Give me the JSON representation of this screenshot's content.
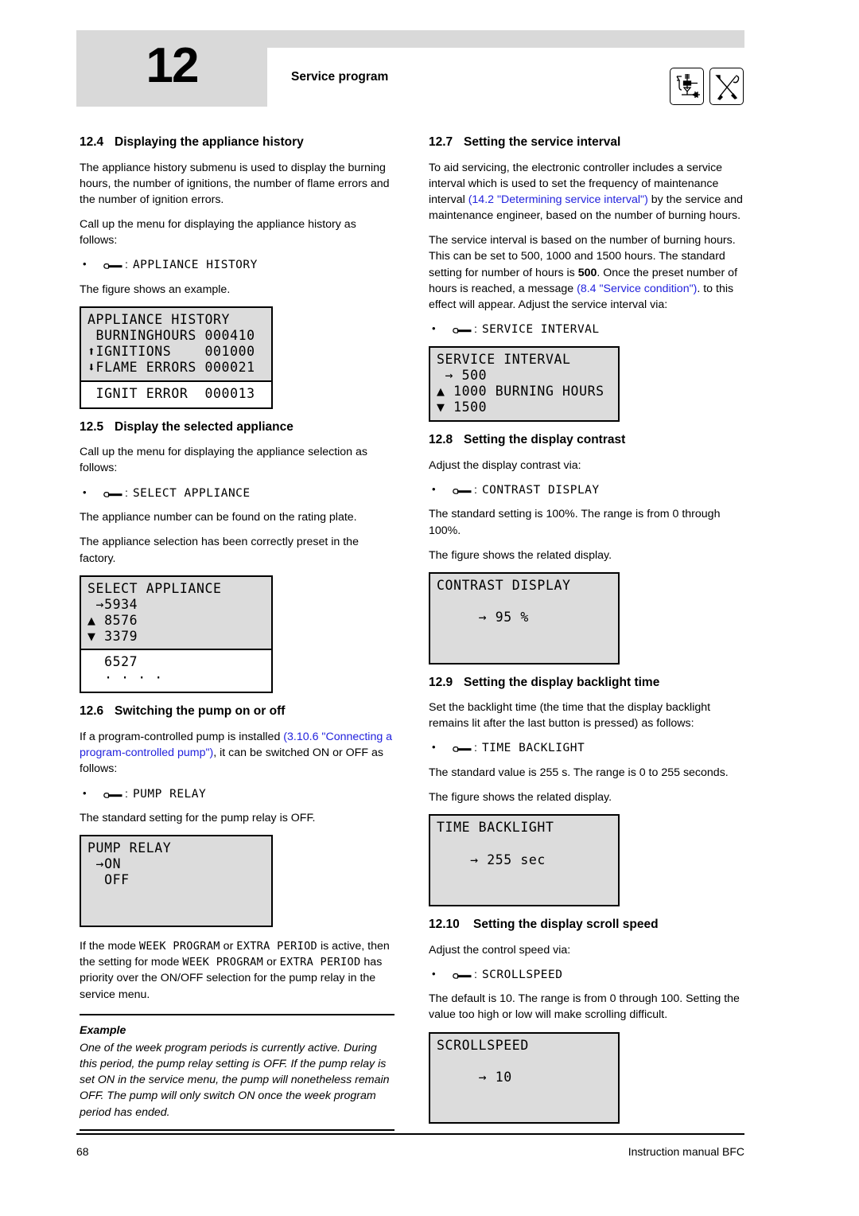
{
  "header": {
    "chapter_number": "12",
    "chapter_title": "Service program",
    "icons": [
      "gas-valve-train-icon",
      "crossed-tools-icon"
    ]
  },
  "colors": {
    "link": "#2222dd",
    "header_band": "#d9d9d9",
    "lcd_background": "#dcdcdc",
    "lcd_border": "#000000"
  },
  "left_column": {
    "sections": [
      {
        "number": "12.4",
        "title": "Displaying the appliance history",
        "paragraphs": [
          "The appliance history submenu is used to display the burning hours, the number of ignitions, the number of flame errors and the number of ignition errors.",
          "Call up the menu for displaying the appliance history as follows:"
        ],
        "bullet": {
          "icon": "wrench-icon",
          "separator": ":",
          "menu_path": "APPLIANCE HISTORY"
        },
        "bullet_note": "The figure shows an example.",
        "lcd": {
          "name": "appliance-history-display",
          "lines": [
            "APPLIANCE HISTORY",
            " BURNINGHOURS 000410",
            "⬆IGNITIONS    001000",
            "⬇FLAME ERRORS 000021"
          ],
          "white_lines": [
            " IGNIT ERROR  000013"
          ]
        }
      },
      {
        "number": "12.5",
        "title": "Display the selected appliance",
        "paragraphs": [
          "Call up the menu for displaying the appliance selection as follows:"
        ],
        "bullet": {
          "icon": "wrench-icon",
          "separator": ":",
          "menu_path": "SELECT APPLIANCE"
        },
        "indent_paragraphs": [
          "The appliance number can be found on the rating plate.",
          "The appliance selection has been correctly preset in the factory."
        ],
        "lcd": {
          "name": "select-appliance-display",
          "lines": [
            "SELECT APPLIANCE",
            " →5934",
            "▲ 8576",
            "▼ 3379"
          ],
          "white_lines": [
            "  6527",
            "  · · · ·"
          ]
        }
      },
      {
        "number": "12.6",
        "title": "Switching the pump on or off",
        "rich_paragraph": {
          "part1": "If a program-controlled pump is installed ",
          "link": "(3.10.6 \"Connecting a program-controlled pump\")",
          "part2": ", it can be switched ON or OFF as follows:"
        },
        "bullet": {
          "icon": "wrench-icon",
          "separator": ":",
          "menu_path": "PUMP RELAY"
        },
        "indent_paragraphs": [
          "The standard setting for the pump relay is OFF."
        ],
        "lcd": {
          "name": "pump-relay-display",
          "lines": [
            "PUMP RELAY",
            " →ON",
            "  OFF",
            ""
          ]
        },
        "mode_paragraph": {
          "t1": "If the mode ",
          "m1": "WEEK PROGRAM",
          "t2": " or ",
          "m2": "EXTRA PERIOD",
          "t3": " is active, then the setting for mode ",
          "m3": "WEEK PROGRAM",
          "t4": " or ",
          "m4": "EXTRA PERIOD",
          "t5": " has priority over the ON/OFF selection for the pump relay in the service menu."
        },
        "example": {
          "heading": "Example",
          "text": "One of the week program periods is currently active. During this period, the pump relay setting is OFF. If the pump relay is set ON in the service menu, the pump will nonetheless remain OFF. The pump will only switch ON once the week program period has ended."
        }
      }
    ]
  },
  "right_column": {
    "sections": [
      {
        "number": "12.7",
        "title": "Setting the service interval",
        "rich_paragraph_1": {
          "part1": "To aid servicing, the electronic controller includes a service interval which is used to set the frequency of maintenance interval ",
          "link": "(14.2 \"Determining service interval\")",
          "part2": " by the service and maintenance engineer, based on the number of burning hours."
        },
        "rich_paragraph_2": {
          "part1": "The service interval is based on the number of burning hours. This can be set to 500, 1000 and 1500 hours. The standard setting for number of hours is ",
          "bold": "500",
          "part2": ". Once the preset number of hours is reached, a message ",
          "link": "(8.4 \"Service condition\")",
          "part3": ". to this effect will appear. Adjust the service interval via:"
        },
        "bullet": {
          "icon": "wrench-icon",
          "separator": ":",
          "menu_path": "SERVICE INTERVAL"
        },
        "lcd": {
          "name": "service-interval-display",
          "lines": [
            "SERVICE INTERVAL",
            " → 500",
            "▲ 1000 BURNING HOURS",
            "▼ 1500"
          ]
        }
      },
      {
        "number": "12.8",
        "title": "Setting the display contrast",
        "paragraphs": [
          "Adjust the display contrast via:"
        ],
        "bullet": {
          "icon": "wrench-icon",
          "separator": ":",
          "menu_path": "CONTRAST DISPLAY"
        },
        "indent_paragraphs": [
          "The standard setting is 100%. The range is from 0 through 100%.",
          "The figure shows the related display."
        ],
        "lcd": {
          "name": "contrast-display-display",
          "lines": [
            "CONTRAST DISPLAY",
            "",
            "     → 95 %",
            ""
          ]
        }
      },
      {
        "number": "12.9",
        "title": "Setting the display backlight time",
        "paragraphs": [
          "Set the backlight time (the time that the display backlight remains lit after the last button is pressed) as follows:"
        ],
        "bullet": {
          "icon": "wrench-icon",
          "separator": ":",
          "menu_path": "TIME BACKLIGHT"
        },
        "indent_paragraphs": [
          "The standard value is 255 s. The range is 0 to 255 seconds.",
          "The figure shows the related display."
        ],
        "lcd": {
          "name": "time-backlight-display",
          "lines": [
            "TIME BACKLIGHT",
            "",
            "    → 255 sec",
            ""
          ]
        }
      },
      {
        "number": "12.10",
        "title": "Setting the display scroll speed",
        "paragraphs": [
          "Adjust the control speed via:"
        ],
        "bullet": {
          "icon": "wrench-icon",
          "separator": ":",
          "menu_path": "SCROLLSPEED"
        },
        "indent_paragraphs": [
          "The default is 10. The range is from 0 through 100. Setting the value too high or low will make scrolling difficult."
        ],
        "lcd": {
          "name": "scrollspeed-display",
          "lines": [
            "SCROLLSPEED",
            "",
            "     → 10",
            ""
          ]
        }
      }
    ]
  },
  "footer": {
    "page_number": "68",
    "manual_title": "Instruction manual BFC"
  }
}
